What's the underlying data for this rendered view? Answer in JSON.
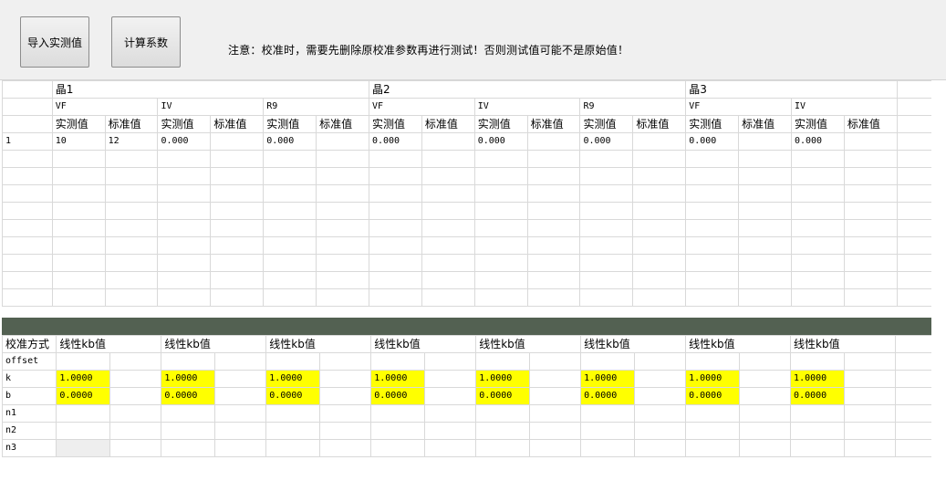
{
  "toolbar": {
    "import_label": "导入实测值",
    "calc_label": "计算系数",
    "notice": "注意：校准时，需要先删除原校准参数再进行测试！否则测试值可能不是原始值！"
  },
  "upper_grid": {
    "chips": [
      "晶1",
      "晶2",
      "晶3"
    ],
    "params": [
      "VF",
      "IV",
      "R9",
      "VF",
      "IV",
      "R9",
      "VF",
      "IV"
    ],
    "measured_label": "实测值",
    "standard_label": "标准值",
    "row_index": "1",
    "row_values": [
      "10",
      "12",
      "0.000",
      "",
      "0.000",
      "",
      "0.000",
      "",
      "0.000",
      "",
      "0.000",
      "",
      "0.000",
      "",
      "0.000",
      ""
    ]
  },
  "lower_grid": {
    "method_label": "校准方式",
    "method_value": "线性kb值",
    "rows": [
      "offset",
      "k",
      "b",
      "n1",
      "n2",
      "n3"
    ],
    "k_value": "1.0000",
    "b_value": "0.0000"
  },
  "colors": {
    "toolbar_bg": "#f0f0f0",
    "divider": "#536152",
    "highlight": "#ffff00"
  }
}
